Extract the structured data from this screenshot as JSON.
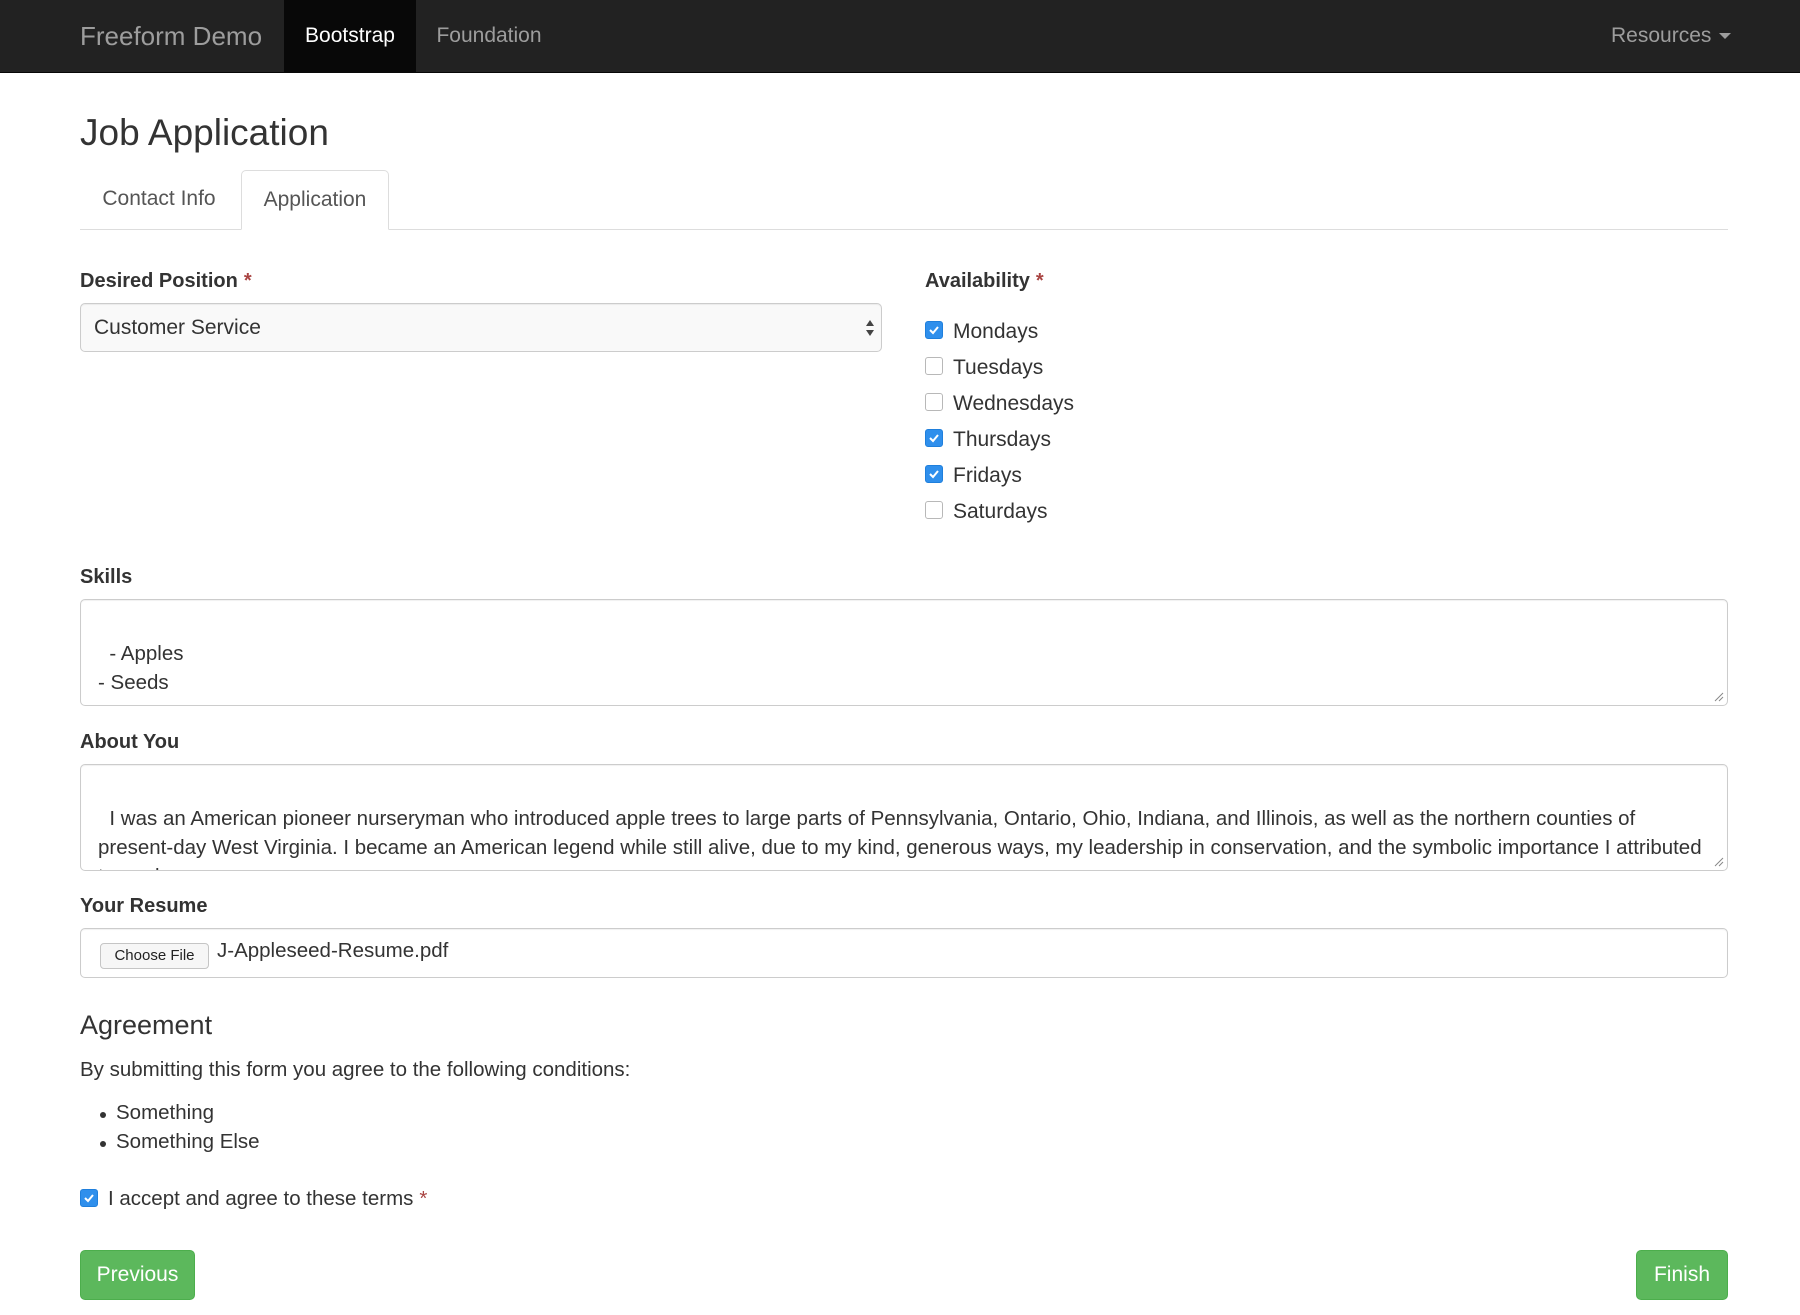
{
  "navbar": {
    "brand": "Freeform Demo",
    "items": [
      {
        "label": "Bootstrap",
        "active": true
      },
      {
        "label": "Foundation",
        "active": false
      }
    ],
    "resources_label": "Resources"
  },
  "page": {
    "title": "Job Application",
    "tabs": [
      {
        "label": "Contact Info",
        "active": false
      },
      {
        "label": "Application",
        "active": true
      }
    ]
  },
  "form": {
    "required_marker": "*",
    "desired_position": {
      "label": "Desired Position",
      "value": "Customer Service"
    },
    "availability": {
      "label": "Availability",
      "options": [
        {
          "label": "Mondays",
          "checked": true
        },
        {
          "label": "Tuesdays",
          "checked": false
        },
        {
          "label": "Wednesdays",
          "checked": false
        },
        {
          "label": "Thursdays",
          "checked": true
        },
        {
          "label": "Fridays",
          "checked": true
        },
        {
          "label": "Saturdays",
          "checked": false
        }
      ]
    },
    "skills": {
      "label": "Skills",
      "value": "- Apples\n- Seeds"
    },
    "about_you": {
      "label": "About You",
      "value": "I was an American pioneer nurseryman who introduced apple trees to large parts of Pennsylvania, Ontario, Ohio, Indiana, and Illinois, as well as the northern counties of present-day West Virginia. I became an American legend while still alive, due to my kind, generous ways, my leadership in conservation, and the symbolic importance I attributed to apples."
    },
    "resume": {
      "label": "Your Resume",
      "button_label": "Choose File",
      "file_name": "J-Appleseed-Resume.pdf"
    }
  },
  "agreement": {
    "title": "Agreement",
    "text": "By submitting this form you agree to the following conditions:",
    "conditions": [
      "Something",
      "Something Else"
    ],
    "accept_label": "I accept and agree to these terms",
    "accepted": true
  },
  "buttons": {
    "previous": "Previous",
    "finish": "Finish"
  },
  "colors": {
    "navbar_bg": "#222222",
    "button_green": "#5cb85c",
    "required_red": "#a94442",
    "checkbox_blue": "#2f8fec"
  }
}
